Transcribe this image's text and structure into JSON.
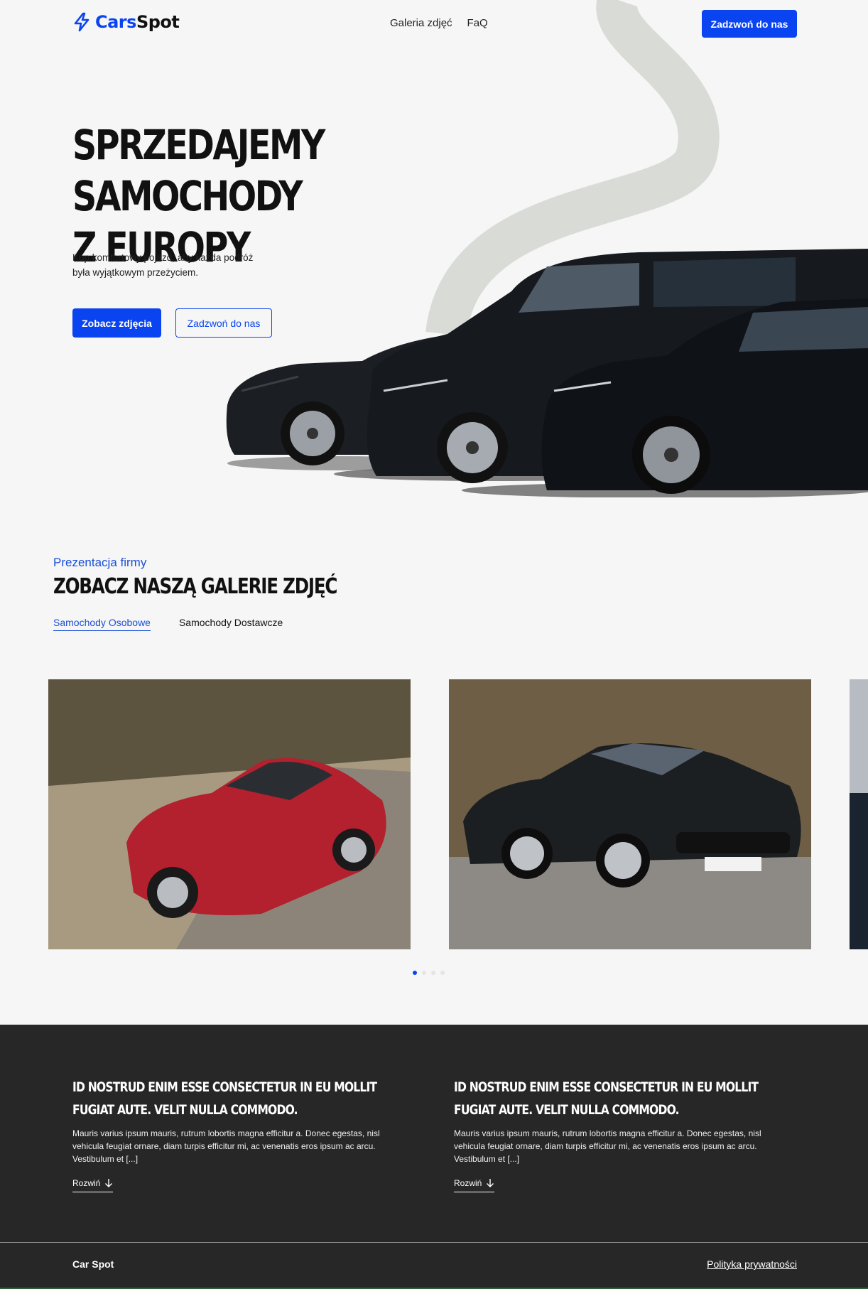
{
  "header": {
    "logo_part1": "Cars",
    "logo_part2": "Spot",
    "nav": [
      "Galeria zdjęć",
      "FaQ"
    ],
    "cta_label": "Zadzwoń do nas"
  },
  "hero": {
    "title_line1": "SPRZEDAJEMY SAMOCHODY",
    "title_line2": "Z EUROPY",
    "subtitle": "Kup komfortowy pojazd, aby każda podróż była wyjątkowym przeżyciem.",
    "primary_button": "Zobacz zdjęcia",
    "secondary_button": "Zadzwoń do nas"
  },
  "gallery": {
    "eyebrow": "Prezentacja firmy",
    "title": "ZOBACZ NASZĄ GALERIE ZDJĘĆ",
    "tabs": [
      "Samochody Osobowe",
      "Samochody Dostawcze"
    ],
    "active_tab": 0,
    "slide_count": 4,
    "active_slide": 0
  },
  "info": {
    "cards": [
      {
        "title": "ID NOSTRUD ENIM ESSE CONSECTETUR IN EU MOLLIT FUGIAT AUTE. VELIT NULLA COMMODO.",
        "text": "Mauris varius ipsum mauris, rutrum lobortis magna efficitur a. Donec egestas, nisl vehicula feugiat ornare, diam turpis efficitur mi, ac venenatis eros ipsum ac arcu. Vestibulum et [...]",
        "link": "Rozwiń"
      },
      {
        "title": "ID NOSTRUD ENIM ESSE CONSECTETUR IN EU MOLLIT FUGIAT AUTE. VELIT NULLA COMMODO.",
        "text": "Mauris varius ipsum mauris, rutrum lobortis magna efficitur a. Donec egestas, nisl vehicula feugiat ornare, diam turpis efficitur mi, ac venenatis eros ipsum ac arcu. Vestibulum et [...]",
        "link": "Rozwiń"
      }
    ]
  },
  "footer": {
    "brand": "Car Spot",
    "privacy_link": "Polityka prywatności"
  },
  "colors": {
    "accent": "#0a44f0",
    "dark_bg": "#272727",
    "page_bg": "#f6f6f6",
    "road": "#d9dcd6"
  },
  "icons": [
    "bolt-icon",
    "arrow-down-icon"
  ]
}
